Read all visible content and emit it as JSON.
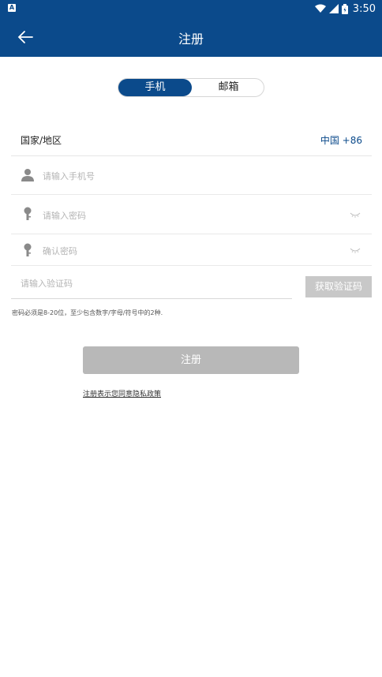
{
  "status_bar": {
    "notification_glyph": "A",
    "time": "3:50"
  },
  "app_bar": {
    "title": "注册",
    "back_icon": "arrow-left-icon"
  },
  "tabs": [
    {
      "label": "手机",
      "active": true
    },
    {
      "label": "邮箱",
      "active": false
    }
  ],
  "country": {
    "label": "国家/地区",
    "value": "中国 +86"
  },
  "fields": {
    "phone": {
      "placeholder": "请输入手机号",
      "icon": "user-icon"
    },
    "password": {
      "placeholder": "请输入密码",
      "icon": "key-icon"
    },
    "confirm_password": {
      "placeholder": "确认密码",
      "icon": "key-icon"
    },
    "verification_code": {
      "placeholder": "请输入验证码"
    }
  },
  "get_code_button": "获取验证码",
  "password_hint": "密码必须是8-20位，至少包含数字/字母/符号中的2种.",
  "submit_button": "注册",
  "policy_link": "注册表示您同意隐私政策",
  "colors": {
    "primary": "#0b4a8b",
    "disabled_button": "#b8b8b8",
    "placeholder": "#b4b4b4"
  }
}
